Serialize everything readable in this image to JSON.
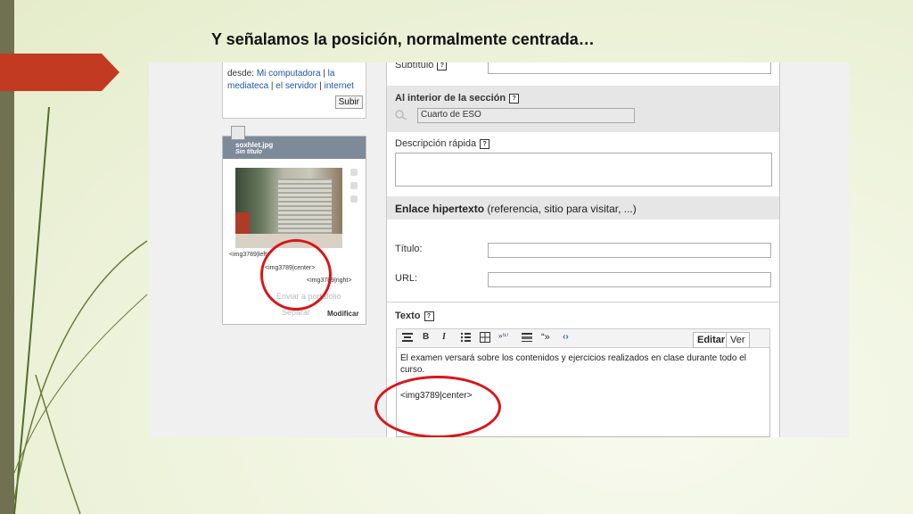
{
  "slide": {
    "title": "Y señalamos la posición, normalmente centrada…"
  },
  "upload": {
    "prefix": "desde: ",
    "source_computer": "Mi computadora",
    "sep1": " | ",
    "source_media_1": "la",
    "source_media_2": "mediateca",
    "sep2": " | ",
    "source_server": "el servidor",
    "sep3": " | ",
    "source_internet": "internet",
    "submit_label": "Subir"
  },
  "document": {
    "filename": "soxhlet.jpg",
    "subtitle": "Sin título",
    "tag_left": "<img3789|left>",
    "tag_center": "<img3789|center>",
    "tag_right": "<img3789|right>",
    "action_portfolio": "Enviar a portafolio",
    "action_separate": "Separar",
    "action_modify": "Modificar"
  },
  "form": {
    "subtitle_label": "Subtítulo",
    "section_label": "Al interior de la sección",
    "section_value": "Cuarto de ESO",
    "description_label": "Descripción rápida",
    "hyperlink_bold": "Enlace hipertexto",
    "hyperlink_note": " (referencia, sitio para visitar, ...)",
    "link_title_label": "Título:",
    "url_label": "URL:",
    "text_label": "Texto",
    "help_glyph": "?"
  },
  "editor": {
    "tab_edit": "Editar",
    "tab_view": "Ver",
    "paragraph": "El examen versará sobre los contenidos y ejercicios realizados en clase durante todo el curso.",
    "image_tag": "<img3789|center>"
  },
  "colors": {
    "annotation_circle": "#d8161a",
    "accent_arrow": "#c23a22",
    "left_bar": "#6f7151"
  }
}
